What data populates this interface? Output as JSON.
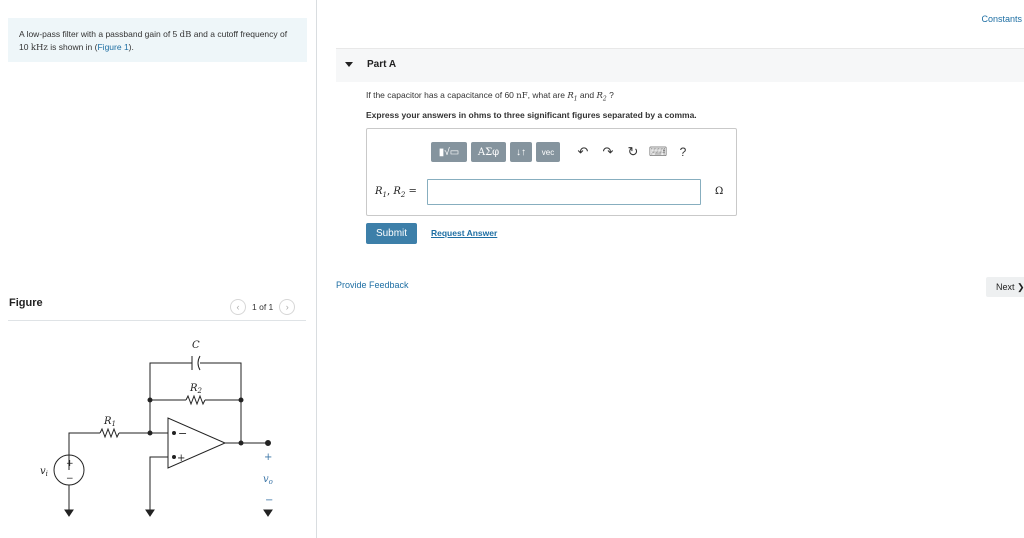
{
  "intro": {
    "text_a": "A low-pass filter with a passband gain of 5 ",
    "unit_db": "dB",
    "text_b": " and a cutoff frequency of 10 ",
    "unit_khz": "kHz",
    "text_c": " is shown in (",
    "figure_link": "Figure 1",
    "text_d": ")."
  },
  "figure": {
    "label": "Figure",
    "pager_text": "1 of 1",
    "prev_icon": "‹",
    "next_icon": "›",
    "circuit": {
      "c": "C",
      "r2": "R",
      "r2_sub": "2",
      "r1": "R",
      "r1_sub": "1",
      "vi": "v",
      "vi_sub": "i",
      "vo": "v",
      "vo_sub": "o",
      "minus": "−",
      "plus": "+",
      "src_plus": "+",
      "src_minus": "−",
      "out_plus": "+",
      "out_minus": "−"
    }
  },
  "header": {
    "constants_link": "Constants"
  },
  "part": {
    "title": "Part A",
    "question_a": "If the capacitor has a capacitance of 60 ",
    "cap_unit": "nF",
    "question_b": ", what are ",
    "r1": "R",
    "r1_sub": "1",
    "and": " and ",
    "r2": "R",
    "r2_sub": "2",
    "question_c": " ?",
    "express": "Express your answers in ohms to three significant figures separated by a comma."
  },
  "toolbar": {
    "templates_label": "▮√▭",
    "symbols_label": "ΑΣφ",
    "sort_label": "↓↑",
    "vec_label": "vec",
    "undo_icon": "↶",
    "redo_icon": "↷",
    "reset_icon": "↻",
    "keyboard_icon": "⌨",
    "help_label": "?"
  },
  "answer": {
    "label_r1": "R",
    "label_r1_sub": "1",
    "label_sep": ", ",
    "label_r2": "R",
    "label_r2_sub": "2",
    "label_eq": " =",
    "value": "",
    "unit": "Ω"
  },
  "actions": {
    "submit_label": "Submit",
    "request_label": "Request Answer",
    "feedback_label": "Provide Feedback",
    "next_label": "Next ❯"
  }
}
